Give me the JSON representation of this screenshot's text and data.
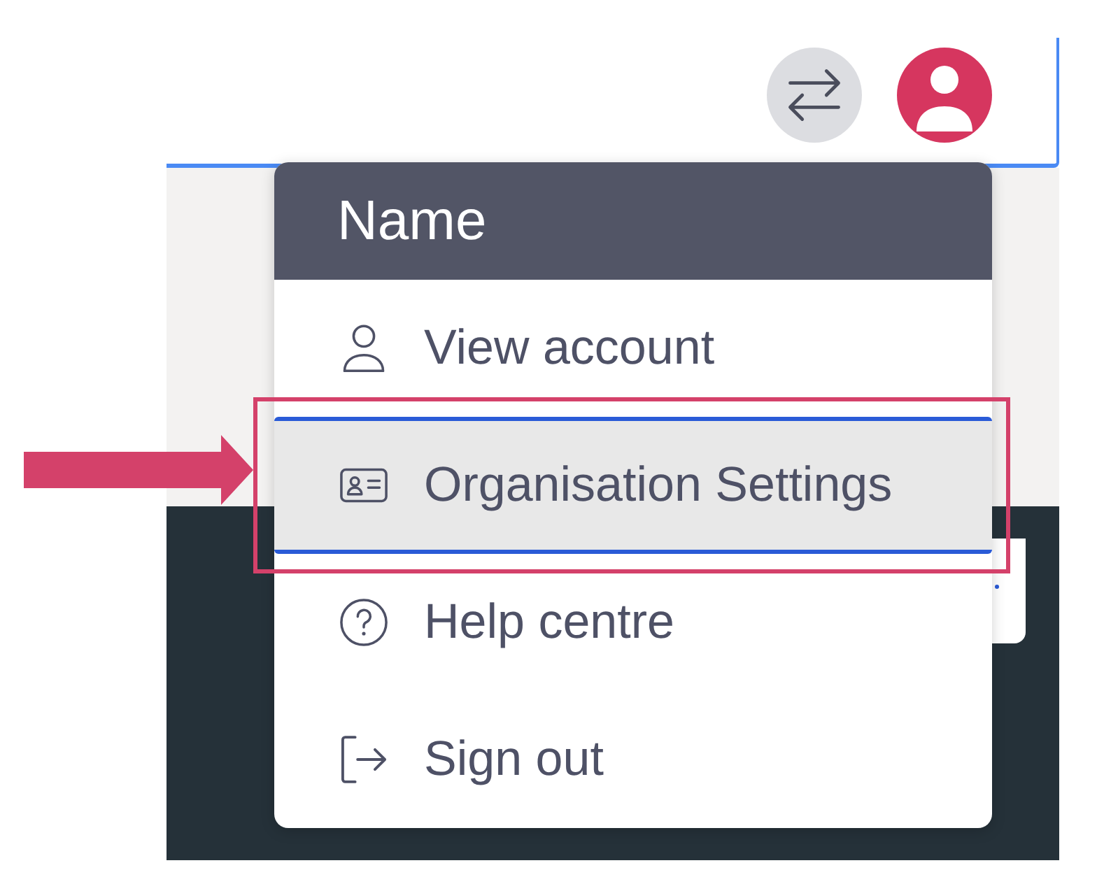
{
  "menu": {
    "title": "Name",
    "items": [
      {
        "kind": "account",
        "label": "View account",
        "selected": false,
        "annotated": false
      },
      {
        "kind": "organisation",
        "label": "Organisation Settings",
        "selected": true,
        "annotated": true
      },
      {
        "kind": "help",
        "label": "Help centre",
        "selected": false,
        "annotated": false
      },
      {
        "kind": "sign_out",
        "label": "Sign out",
        "selected": false,
        "annotated": false
      }
    ]
  }
}
